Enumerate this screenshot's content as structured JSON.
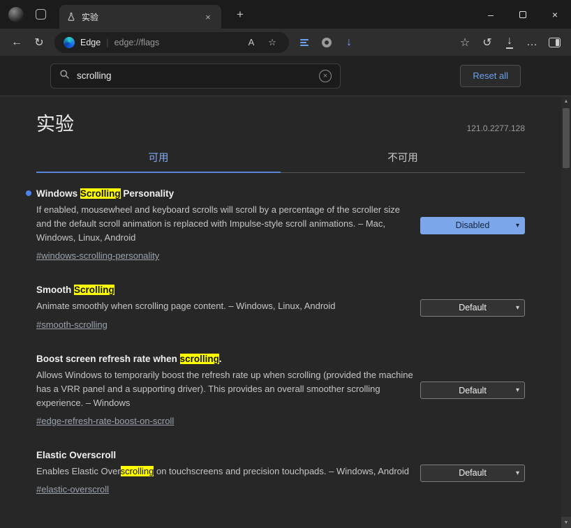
{
  "icons": {
    "back": "←",
    "refresh": "↻",
    "star": "☆",
    "read_aloud": "A",
    "ext_arrow": "↓",
    "favorites_hub": "☆",
    "history": "↺",
    "download": "↓",
    "more": "…",
    "plus": "+",
    "close": "×",
    "minimize": "–",
    "chevron_down": "▾",
    "scroll_up": "▲",
    "scroll_down": "▼",
    "clear": "×",
    "divider": "|"
  },
  "window": {
    "tab_title": "实验"
  },
  "toolbar": {
    "brand": "Edge",
    "url": "edge://flags"
  },
  "search": {
    "value": "scrolling",
    "reset_label": "Reset all"
  },
  "page": {
    "title": "实验",
    "version": "121.0.2277.128",
    "tab_available": "可用",
    "tab_unavailable": "不可用"
  },
  "flags": [
    {
      "title": {
        "pre": "Windows ",
        "hl": "Scrolling",
        "post": " Personality"
      },
      "desc": {
        "pre": "If enabled, mousewheel and keyboard scrolls will scroll by a percentage of the scroller size and the default scroll animation is replaced with Impulse-style scroll animations. – Mac, Windows, Linux, Android",
        "hl": "",
        "post": ""
      },
      "link": "#windows-scrolling-personality",
      "value": "Disabled"
    },
    {
      "title": {
        "pre": "Smooth ",
        "hl": "Scrolling",
        "post": ""
      },
      "desc": {
        "pre": "Animate smoothly when scrolling page content. – Windows, Linux, Android",
        "hl": "",
        "post": ""
      },
      "link": "#smooth-scrolling",
      "value": "Default"
    },
    {
      "title": {
        "pre": "Boost screen refresh rate when ",
        "hl": "scrolling",
        "post": "."
      },
      "desc": {
        "pre": "Allows Windows to temporarily boost the refresh rate up when scrolling (provided the machine has a VRR panel and a supporting driver). This provides an overall smoother scrolling experience. – Windows",
        "hl": "",
        "post": ""
      },
      "link": "#edge-refresh-rate-boost-on-scroll",
      "value": "Default"
    },
    {
      "title": {
        "pre": "Elastic Overscroll",
        "hl": "",
        "post": ""
      },
      "desc": {
        "pre": "Enables Elastic Over",
        "hl": "scrolling",
        "post": " on touchscreens and precision touchpads. – Windows, Android"
      },
      "link": "#elastic-overscroll",
      "value": "Default"
    }
  ]
}
